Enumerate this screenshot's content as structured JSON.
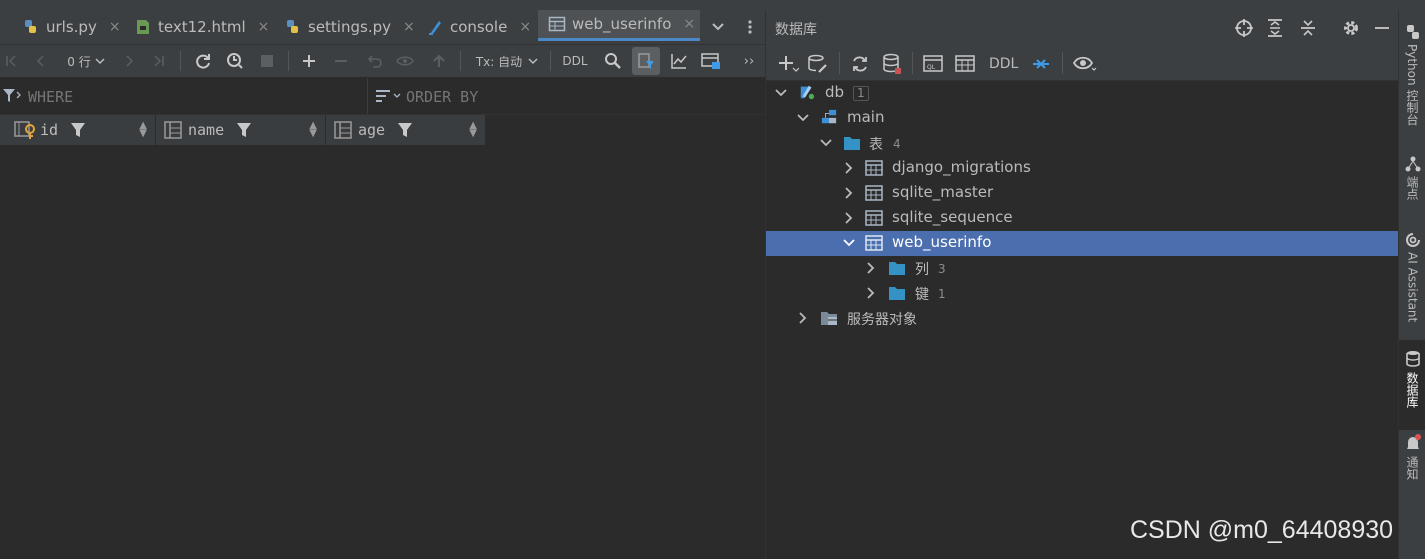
{
  "tabs": [
    {
      "label": "urls.py",
      "icon": "python-file-icon"
    },
    {
      "label": "text12.html",
      "icon": "html-file-icon"
    },
    {
      "label": "settings.py",
      "icon": "python-file-icon"
    },
    {
      "label": "console",
      "icon": "console-icon"
    },
    {
      "label": "web_userinfo",
      "icon": "table-icon",
      "active": true
    }
  ],
  "tab_close_glyph": "×",
  "toolbar": {
    "rows_label": "0 行",
    "tx_label": "Tx: 自动",
    "ddl_label": "DDL",
    "more_glyph": "››"
  },
  "filter": {
    "where_placeholder": "WHERE",
    "orderby_placeholder": "ORDER BY"
  },
  "columns": [
    {
      "name": "id",
      "icon": "primary-key-column-icon"
    },
    {
      "name": "name",
      "icon": "column-icon"
    },
    {
      "name": "age",
      "icon": "column-icon"
    }
  ],
  "db_panel": {
    "title": "数据库",
    "ddl_label": "DDL"
  },
  "tree": {
    "db": {
      "label": "db",
      "count": "1"
    },
    "schema": {
      "label": "main"
    },
    "tables_folder": {
      "label": "表",
      "count": "4"
    },
    "tables": [
      "django_migrations",
      "sqlite_master",
      "sqlite_sequence",
      "web_userinfo"
    ],
    "selected_table": "web_userinfo",
    "columns_folder": {
      "label": "列",
      "count": "3"
    },
    "keys_folder": {
      "label": "键",
      "count": "1"
    },
    "server_objects": {
      "label": "服务器对象"
    }
  },
  "stripe": [
    {
      "label": "Python 控制台",
      "icon": "python-icon"
    },
    {
      "label": "端点",
      "icon": "endpoints-icon"
    },
    {
      "label": "AI Assistant",
      "icon": "ai-assistant-icon"
    },
    {
      "label": "数据库",
      "icon": "database-icon",
      "active": true
    },
    {
      "label": "通知",
      "icon": "notification-bell-icon"
    }
  ],
  "watermark": "CSDN @m0_64408930",
  "colors": {
    "selection": "#4b6eaf",
    "accent_blue": "#4a88c7",
    "folder_blue": "#3592c4",
    "background": "#2b2b2b",
    "panel": "#3c3f41"
  }
}
